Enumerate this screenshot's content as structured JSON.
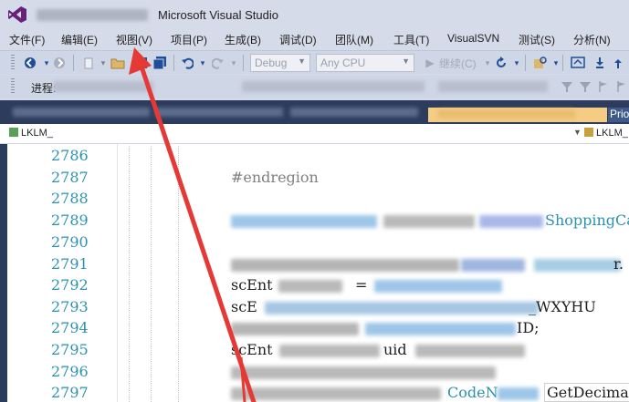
{
  "title_bar": {
    "title": "Microsoft Visual Studio"
  },
  "menu": {
    "items": [
      {
        "label": "文件(F)"
      },
      {
        "label": "编辑(E)"
      },
      {
        "label": "视图(V)"
      },
      {
        "label": "项目(P)"
      },
      {
        "label": "生成(B)"
      },
      {
        "label": "调试(D)"
      },
      {
        "label": "团队(M)"
      },
      {
        "label": "工具(T)"
      },
      {
        "label": "VisualSVN"
      },
      {
        "label": "测试(S)"
      },
      {
        "label": "分析(N)"
      }
    ]
  },
  "toolbar": {
    "config_combo": "Debug",
    "platform_combo": "Any CPU",
    "start_label": "继续(C)",
    "icons": [
      "navigate-back-icon",
      "navigate-forward-icon",
      "new-project-icon",
      "open-folder-icon",
      "save-icon",
      "save-all-icon",
      "undo-icon",
      "redo-icon",
      "start-icon",
      "refresh-icon",
      "find-icon"
    ]
  },
  "toolbar2": {
    "label": "进程:"
  },
  "tabs": {
    "partial_tab": "Prio"
  },
  "navbar": {
    "left": "LKLM_",
    "right": "LKLM_"
  },
  "editor": {
    "line_numbers": [
      "2786",
      "2787",
      "2788",
      "2789",
      "2790",
      "2791",
      "2792",
      "2793",
      "2794",
      "2795",
      "2796",
      "2797"
    ],
    "code_lines": [
      {
        "line": "2787",
        "text": "#endregion"
      },
      {
        "line": "2792",
        "text": "scEnt"
      },
      {
        "line": "2793",
        "text": "scE"
      },
      {
        "line": "2795",
        "text": "scEnt"
      }
    ],
    "visible_fragments": {
      "cart_suffix": "ShoppingCart",
      "line2791_tail": "r.",
      "line2792_eq": "=",
      "line2793_tail": "_WXYHU",
      "line2794_tail": "ID;",
      "line2795_mid": "uid",
      "line2797_codename": "CodeN",
      "line2797_tail": "GetDecima"
    }
  },
  "colors": {
    "chrome_bg": "#d6dbe9",
    "tab_bar": "#2d3c5c",
    "active_tab": "#f5cc84",
    "line_number": "#2b91af",
    "annotation_arrow": "#e53935"
  }
}
